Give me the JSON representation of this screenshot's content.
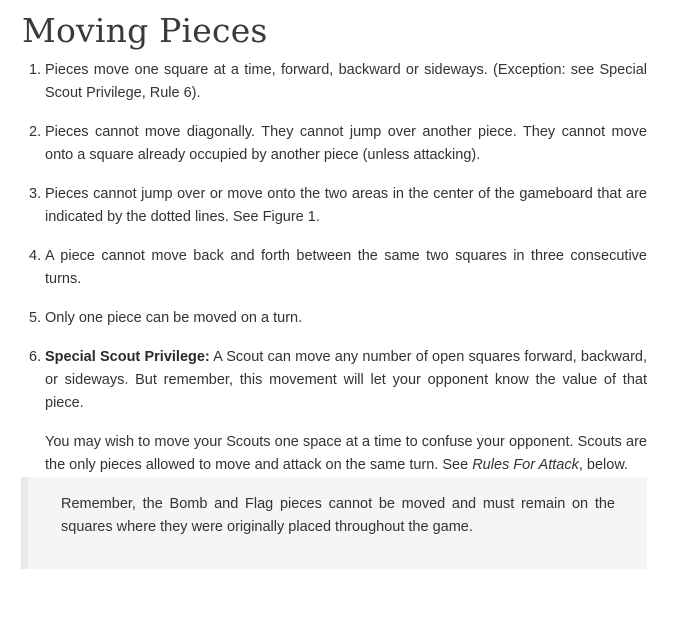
{
  "heading": "Moving Pieces",
  "rules": [
    {
      "number": "1.",
      "text": "Pieces move one square at a time, forward, backward or sideways. (Exception: see Special Scout Privilege, Rule 6)."
    },
    {
      "number": "2.",
      "text": "Pieces cannot move diagonally. They cannot jump over another piece. They cannot move onto a square already occupied by another piece (unless attacking)."
    },
    {
      "number": "3.",
      "text": "Pieces cannot jump over or move onto the two areas in the center of the gameboard that are indicated by the dotted lines. See Figure 1."
    },
    {
      "number": "4.",
      "text": "A piece cannot move back and forth between the same two squares in three consecutive turns."
    },
    {
      "number": "5.",
      "text": "Only one piece can be moved on a turn."
    },
    {
      "number": "6.",
      "title": "Special Scout Privilege:",
      "text": " A Scout can move any number of open squares forward, backward, or sideways. But remember, this movement will let your opponent know the value of that piece."
    }
  ],
  "scout_note": {
    "text_before": "You may wish to move your Scouts one space at a time to confuse your opponent. Scouts are the only pieces allowed to move and attack on the same turn. See ",
    "link_text": "Rules For Attack",
    "text_after": ", below."
  },
  "callout": "Remember, the Bomb and Flag pieces cannot be moved and must remain on the squares where they were originally placed throughout the game."
}
